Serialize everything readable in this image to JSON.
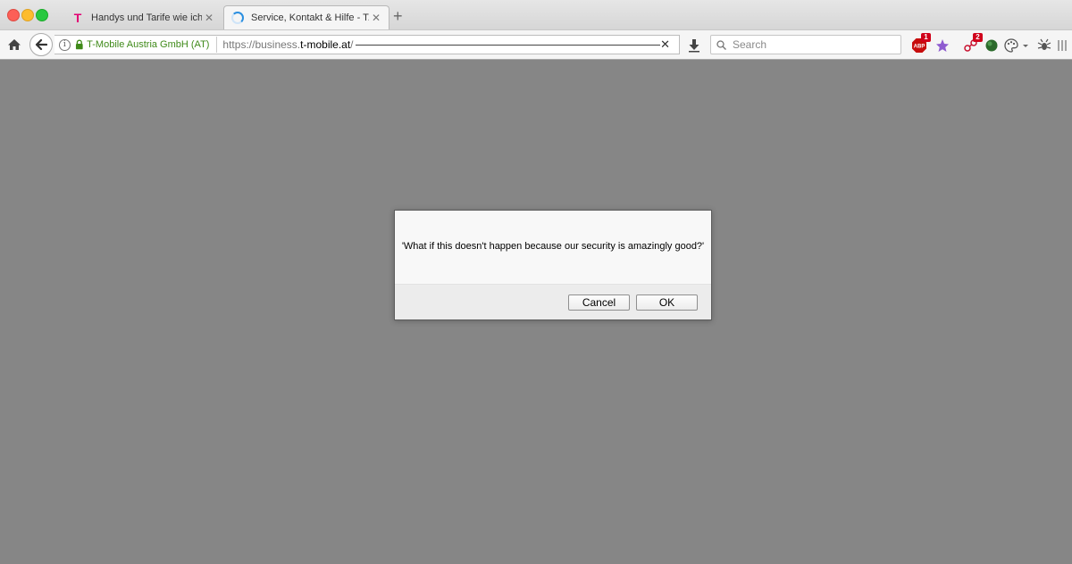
{
  "tabs": [
    {
      "title": "Handys und Tarife wie ich ...",
      "favicon": "t-mobile-logo-icon",
      "logo_text": "T",
      "active": false
    },
    {
      "title": "Service, Kontakt & Hilfe - T...",
      "favicon": "loading-spinner-icon",
      "active": true
    }
  ],
  "newtab_label": "+",
  "tab_close_glyph": "✕",
  "urlbar": {
    "identity": "T-Mobile Austria GmbH (AT)",
    "url_prefix": "https://business.",
    "url_host": "t-mobile.at",
    "url_suffix": "/",
    "clear_glyph": "✕"
  },
  "search": {
    "placeholder": "Search"
  },
  "extensions": [
    {
      "name": "adblock-plus-icon",
      "badge": "1",
      "label": "ABP"
    },
    {
      "name": "star-extension-icon"
    },
    {
      "name": "network-extension-icon",
      "badge": "2"
    },
    {
      "name": "green-circle-extension-icon"
    },
    {
      "name": "palette-extension-icon"
    },
    {
      "name": "bug-extension-icon"
    }
  ],
  "dialog": {
    "message": "'What if this doesn't happen because our security is amazingly good?'",
    "cancel_label": "Cancel",
    "ok_label": "OK"
  },
  "colors": {
    "page_overlay": "#868686",
    "identity_green": "#3f8a19",
    "tmobile_magenta": "#e20074",
    "badge_red": "#d0021b"
  }
}
